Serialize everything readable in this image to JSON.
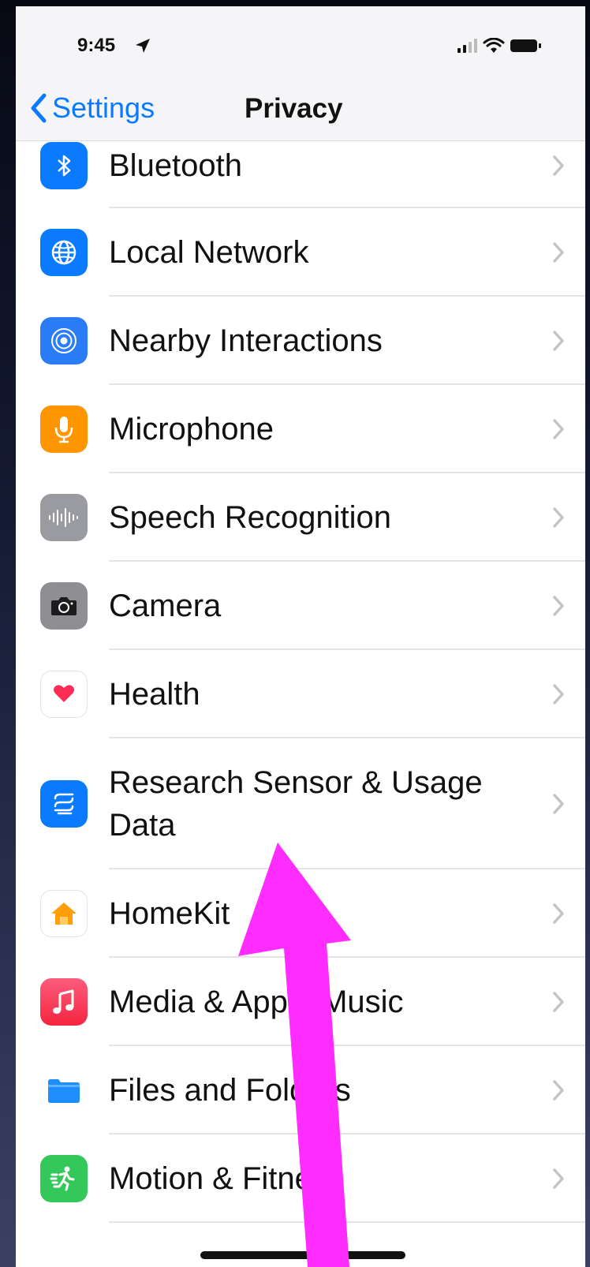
{
  "status_bar": {
    "time": "9:45"
  },
  "nav": {
    "back_label": "Settings",
    "title": "Privacy"
  },
  "items": [
    {
      "label": "Bluetooth",
      "icon": "bluetooth-icon",
      "color": "#0a7aff"
    },
    {
      "label": "Local Network",
      "icon": "globe-icon",
      "color": "#0a7aff"
    },
    {
      "label": "Nearby Interactions",
      "icon": "nearby-interactions-icon",
      "color": "#0a7aff"
    },
    {
      "label": "Microphone",
      "icon": "microphone-icon",
      "color": "#ff9500"
    },
    {
      "label": "Speech Recognition",
      "icon": "waveform-icon",
      "color": "#8e8e93"
    },
    {
      "label": "Camera",
      "icon": "camera-icon",
      "color": "#8e8e93"
    },
    {
      "label": "Health",
      "icon": "heart-icon",
      "color": "#ff2d55"
    },
    {
      "label": "Research Sensor & Usage Data",
      "icon": "research-icon",
      "color": "#0a7aff"
    },
    {
      "label": "HomeKit",
      "icon": "house-icon",
      "color": "#ff9500"
    },
    {
      "label": "Media & Apple Music",
      "icon": "music-note-icon",
      "color": "#fa2d48"
    },
    {
      "label": "Files and Folders",
      "icon": "folder-icon",
      "color": "#1e8efe"
    },
    {
      "label": "Motion & Fitness",
      "icon": "fitness-icon",
      "color": "#34c759"
    }
  ],
  "annotation": {
    "arrow_color": "#ff2cff"
  }
}
